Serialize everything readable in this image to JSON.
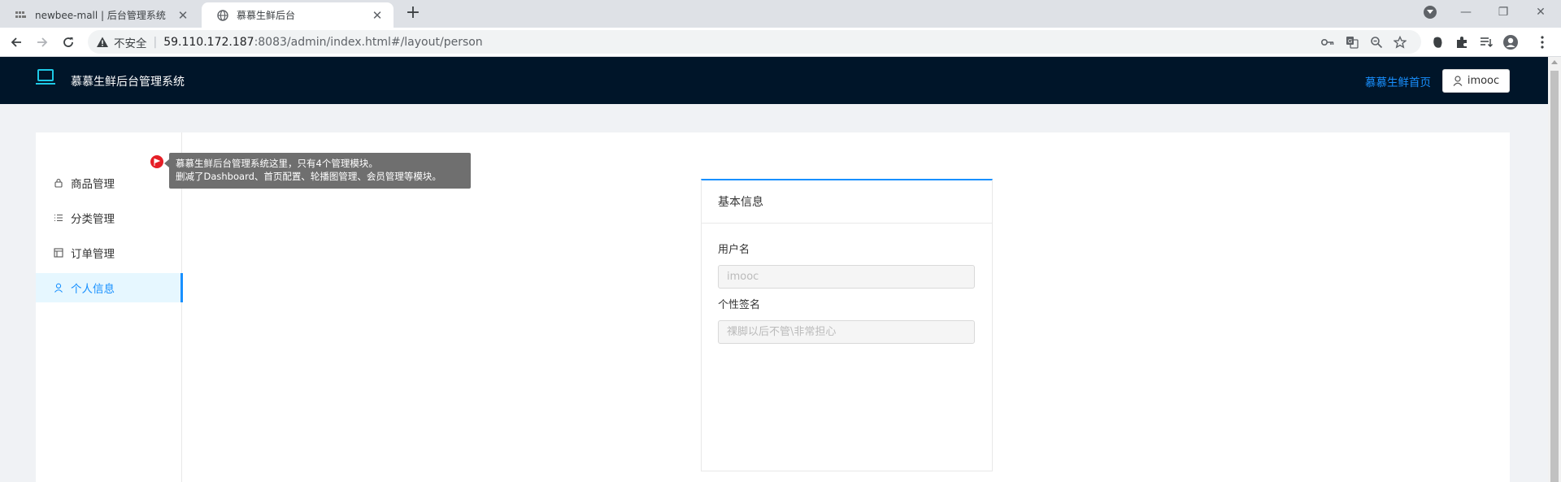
{
  "browser": {
    "tabs": [
      {
        "title": "newbee-mall | 后台管理系统",
        "icon": "newbee-favicon-icon"
      },
      {
        "title": "慕慕生鲜后台",
        "icon": "globe-icon"
      }
    ],
    "address": {
      "security_label": "不安全",
      "host": "59.110.172.187",
      "path": ":8083/admin/index.html#/layout/person"
    }
  },
  "app": {
    "title": "慕慕生鲜后台管理系统",
    "home_link": "慕慕生鲜首页",
    "user_name": "imooc"
  },
  "sidebar": {
    "items": [
      {
        "label": "商品管理",
        "icon": "lock-icon",
        "active": false
      },
      {
        "label": "分类管理",
        "icon": "list-icon",
        "active": false
      },
      {
        "label": "订单管理",
        "icon": "order-icon",
        "active": false
      },
      {
        "label": "个人信息",
        "icon": "user-icon",
        "active": true
      }
    ]
  },
  "tour": {
    "line1": "慕慕生鲜后台管理系统这里，只有4个管理模块。",
    "line2": "删减了Dashboard、首页配置、轮播图管理、会员管理等模块。"
  },
  "profile_card": {
    "title": "基本信息",
    "username_label": "用户名",
    "username_value": "imooc",
    "signature_label": "个性签名",
    "signature_value": "祼脚以后不管\\非常担心"
  },
  "colors": {
    "header_bg": "#001529",
    "accent": "#1890ff",
    "tour_flag": "#e51e26"
  }
}
